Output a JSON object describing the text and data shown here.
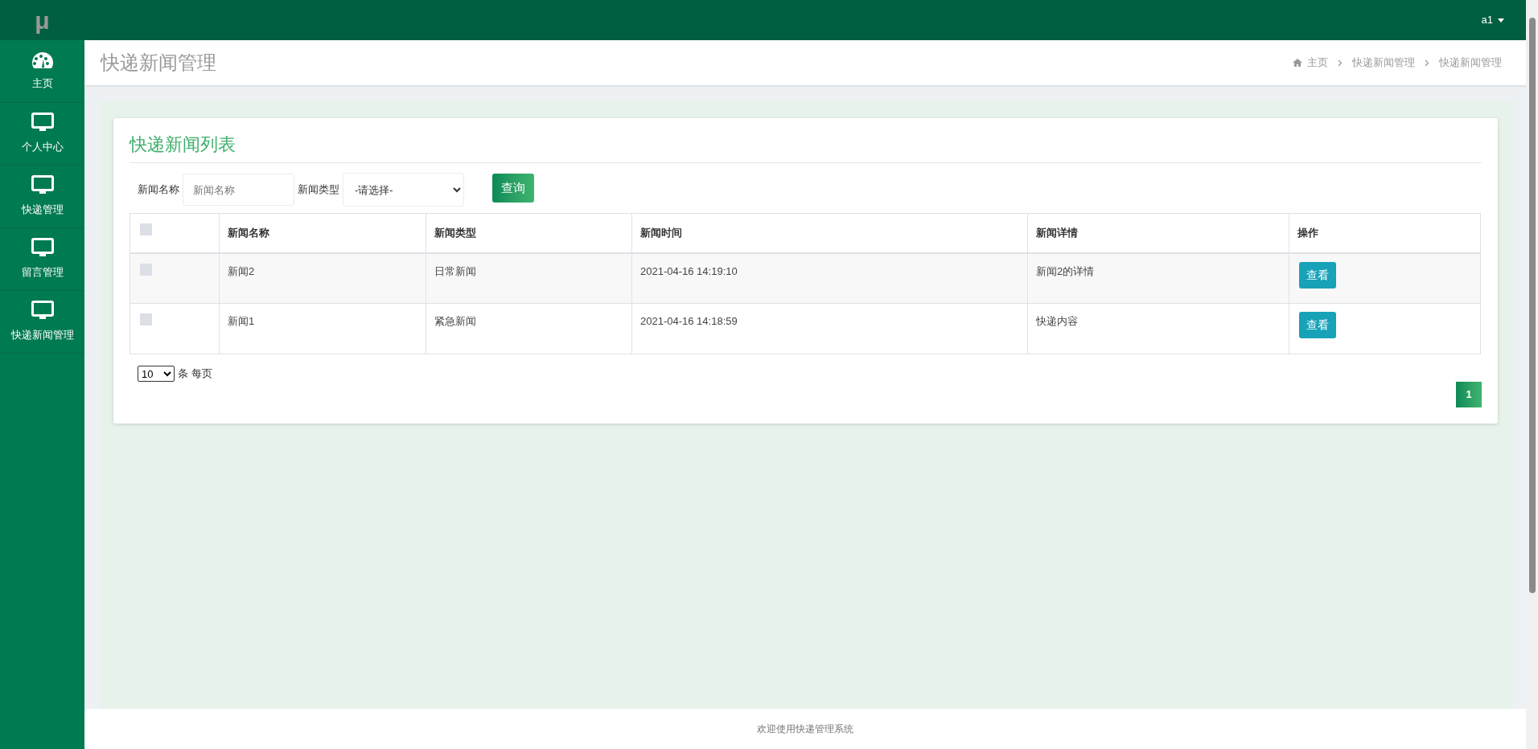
{
  "sidebar": {
    "logo": "μ",
    "items": [
      {
        "label": "主页",
        "kind": "dashboard",
        "selected": false
      },
      {
        "label": "个人中心",
        "kind": "section",
        "selected": false
      },
      {
        "label": "快递管理",
        "kind": "section",
        "selected": false
      },
      {
        "label": "留言管理",
        "kind": "section",
        "selected": false
      },
      {
        "label": "快递新闻管理",
        "kind": "section",
        "selected": false
      }
    ]
  },
  "top_bar": {
    "user": "a1"
  },
  "page_header": {
    "title": "快递新闻管理",
    "breadcrumb": [
      "主页",
      "快递新闻管理",
      "快递新闻管理"
    ]
  },
  "card": {
    "title": "快递新闻列表",
    "filters": [
      {
        "kind": "input",
        "label": "新闻名称",
        "placeholder": "新闻名称"
      },
      {
        "kind": "select",
        "label": "新闻类型",
        "value": "-请选择-"
      }
    ],
    "search_button": "查询",
    "table": {
      "header_checked": false,
      "columns": [
        "新闻名称",
        "新闻类型",
        "新闻时间",
        "新闻详情",
        "操作"
      ],
      "rows": [
        {
          "checked": false,
          "cells": [
            "新闻2",
            "日常新闻",
            "2021-04-16 14:19:10",
            "新闻2的详情"
          ],
          "action": "查看"
        },
        {
          "checked": false,
          "cells": [
            "新闻1",
            "紧急新闻",
            "2021-04-16 14:18:59",
            "快递内容"
          ],
          "action": "查看"
        }
      ]
    },
    "page_size": "10",
    "page_size_label": "条 每页",
    "pages": [
      {
        "label": "1",
        "selected": true
      }
    ]
  },
  "footer": "欢迎使用快递管理系统"
}
